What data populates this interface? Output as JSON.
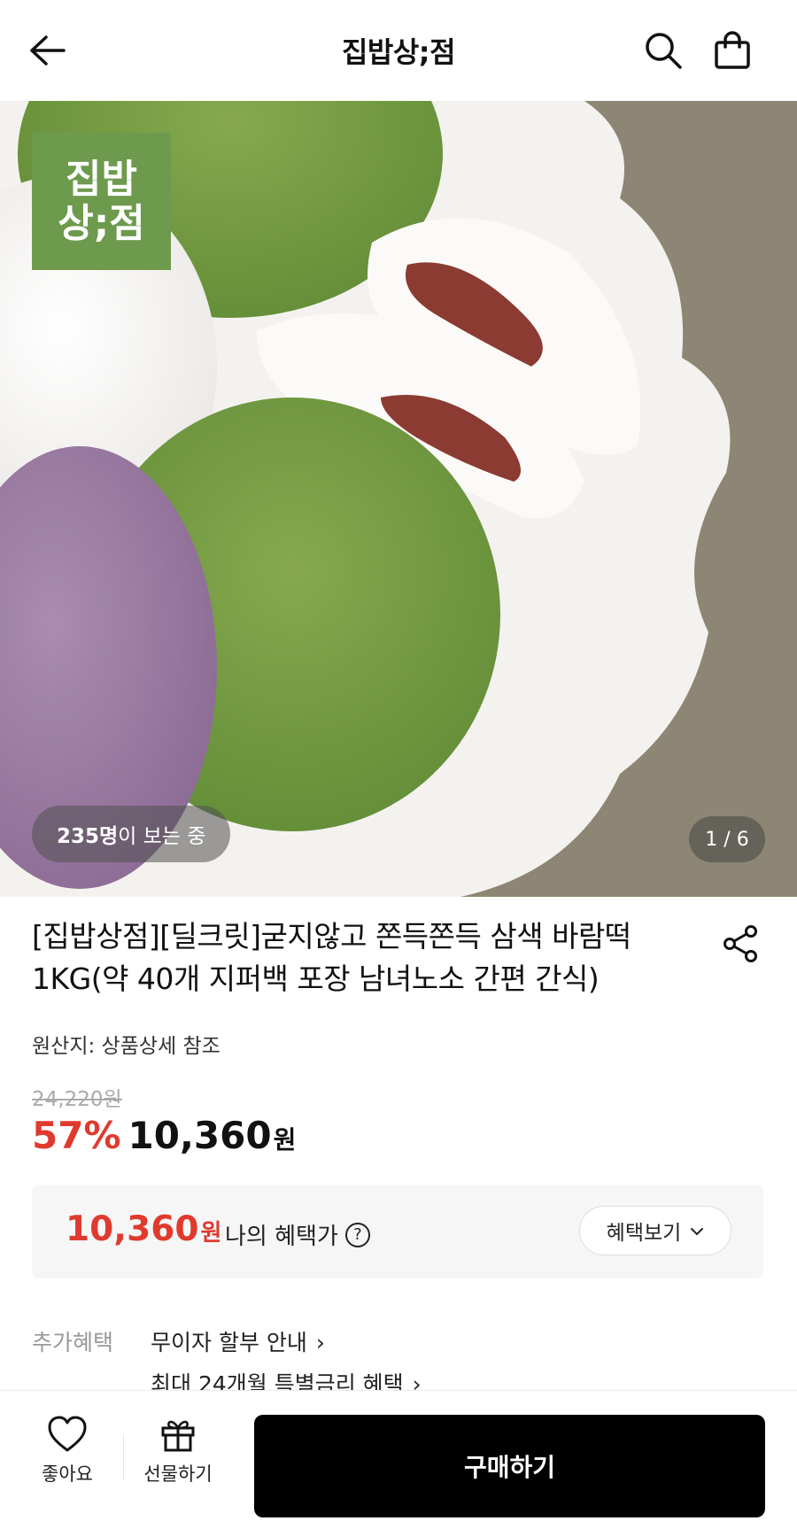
{
  "header": {
    "title": "집밥상;점"
  },
  "hero": {
    "logo_line1": "집밥",
    "logo_line2": "상;점",
    "viewers_count": "235명",
    "viewers_text": "이 보는 중",
    "pager": "1 / 6"
  },
  "product": {
    "title": "[집밥상점][딜크릿]굳지않고 쫀득쫀득 삼색 바람떡 1KG(약 40개 지퍼백 포장 남녀노소 간편 간식)",
    "origin": "원산지: 상품상세 참조",
    "original_price": "24,220원",
    "discount": "57%",
    "sale_price": "10,360",
    "currency": "원"
  },
  "benefit": {
    "price": "10,360",
    "currency": "원",
    "label": "나의 혜택가",
    "button_label": "혜택보기"
  },
  "extra_benefits": {
    "label": "추가혜택",
    "items": [
      "무이자 할부 안내",
      "최대 24개월 특별금리 혜택"
    ]
  },
  "bottom_bar": {
    "like_label": "좋아요",
    "gift_label": "선물하기",
    "buy_label": "구매하기"
  },
  "colors": {
    "accent_red": "#e03a2f",
    "logo_green": "#6e9a4e",
    "buy_button": "#000000"
  },
  "icons": [
    "back-arrow-icon",
    "search-icon",
    "shopping-bag-icon",
    "share-icon",
    "help-icon",
    "chevron-down-icon",
    "chevron-right-icon",
    "heart-icon",
    "gift-icon"
  ]
}
